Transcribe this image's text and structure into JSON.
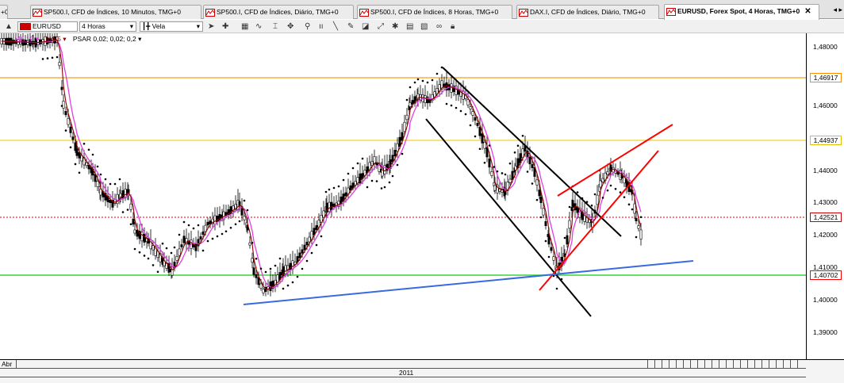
{
  "tabs": [
    {
      "label": "+0",
      "active": false
    },
    {
      "label": "SP500.I, CFD de Índices, 10 Minutos, TMG+0",
      "active": false
    },
    {
      "label": "SP500.I, CFD de Índices, Diário, TMG+0",
      "active": false
    },
    {
      "label": "SP500.I, CFD de Índices, 8 Horas, TMG+0",
      "active": false
    },
    {
      "label": "DAX.I, CFD de Índices, Diário, TMG+0",
      "active": false
    },
    {
      "label": "EURUSD, Forex Spot, 4 Horas, TMG+0",
      "active": true
    }
  ],
  "toolbar": {
    "symbol": "EURUSD",
    "timeframe": "4 Horas",
    "chart_type": "Vela",
    "indicator_glyph": "fx"
  },
  "legend": {
    "ma10": "MA 10 ▾",
    "ma5": "MA 5 ▾",
    "psar": "PSAR 0,02; 0,02; 0,2 ▾"
  },
  "price_axis": {
    "ticks": [
      "1,48000",
      "1,46000",
      "1,44000",
      "1,43000",
      "1,42000",
      "1,41000",
      "1,40000",
      "1,39000"
    ],
    "markers": [
      {
        "label": "1,46917",
        "color": "#ff8c00"
      },
      {
        "label": "1,44937",
        "color": "#e6c000"
      },
      {
        "label": "1,42521",
        "color": "#cc0000"
      },
      {
        "label": "1,40702",
        "color": "#ff0000"
      }
    ]
  },
  "time_axis": {
    "month_label": "Abr",
    "year_label": "2011"
  },
  "colors": {
    "orange_line": "#f4a020",
    "yellow_line": "#f2d22a",
    "red_dotted": "#e00000",
    "green_line": "#3cd43c",
    "blue_trend": "#3a6ae0",
    "channel": "#000000",
    "wedge": "#ff0000",
    "ma10": "#e040e0",
    "ma5": "#8b0000",
    "psar": "#000000"
  }
}
